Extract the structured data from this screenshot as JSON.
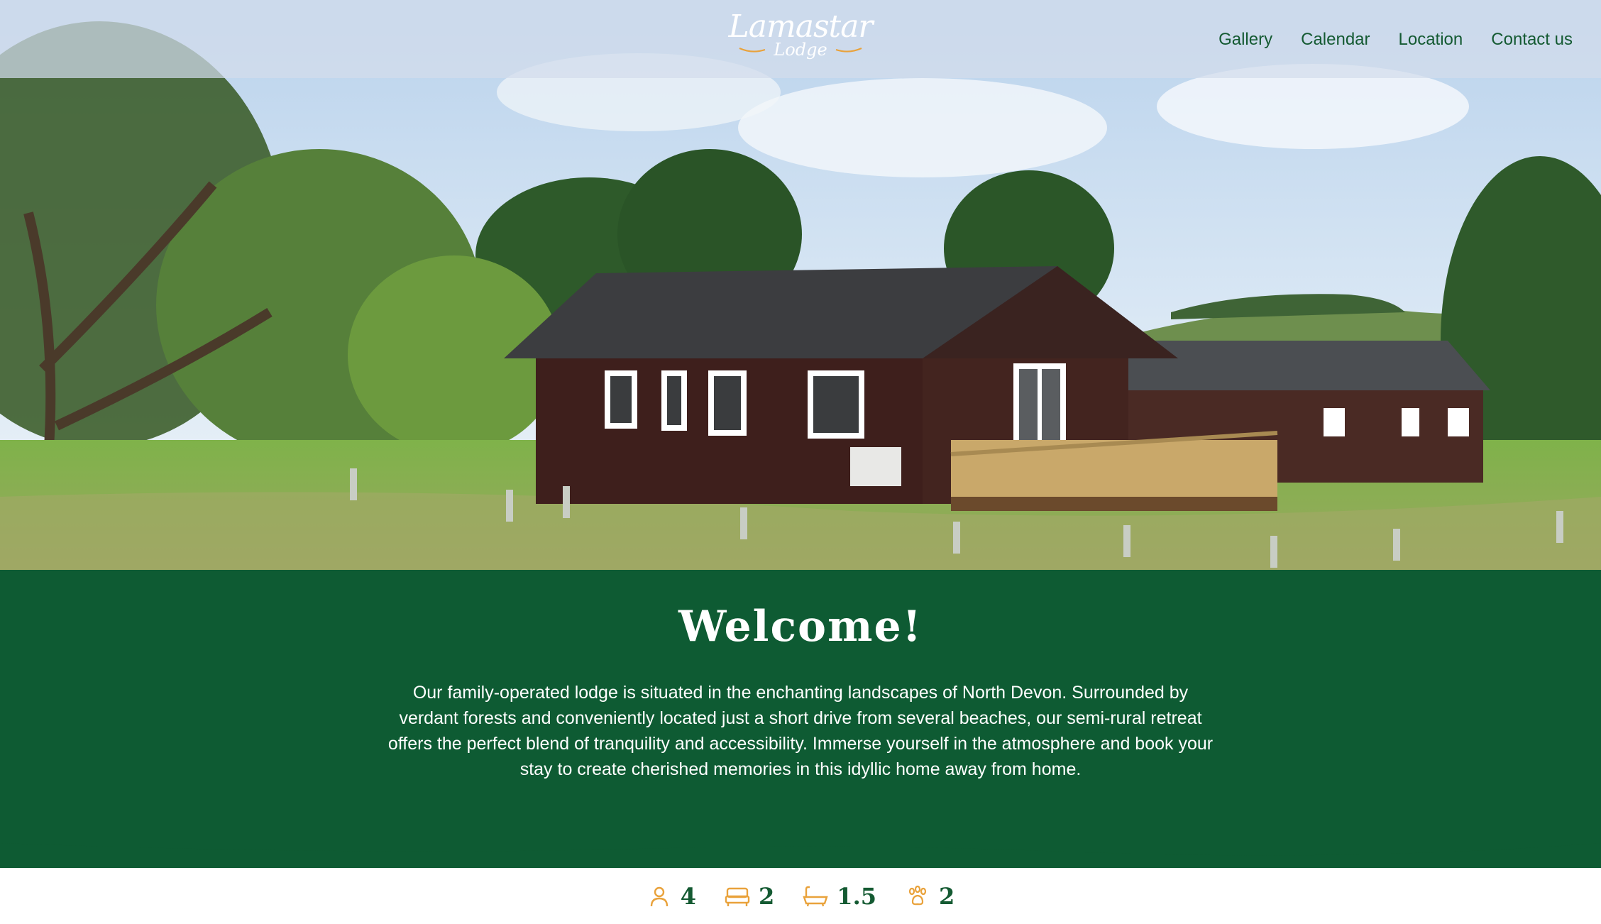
{
  "header": {
    "logo": {
      "main": "Lamastar",
      "sub": "Lodge"
    },
    "nav": [
      {
        "label": "Gallery"
      },
      {
        "label": "Calendar"
      },
      {
        "label": "Location"
      },
      {
        "label": "Contact us"
      }
    ]
  },
  "hero": {
    "icon": "lodge-photo"
  },
  "welcome": {
    "title": "Welcome!",
    "text": "Our family-operated lodge is situated in the enchanting landscapes of North Devon. Surrounded by verdant forests and conveniently located just a short drive from several beaches, our semi-rural retreat offers the perfect blend of tranquility and accessibility. Immerse yourself in the atmosphere and book your stay to create cherished memories in this idyllic home away from home."
  },
  "stats": [
    {
      "icon": "guests-icon",
      "value": "4"
    },
    {
      "icon": "bedrooms-icon",
      "value": "2"
    },
    {
      "icon": "bathrooms-icon",
      "value": "1.5"
    },
    {
      "icon": "pets-icon",
      "value": "2"
    }
  ],
  "colors": {
    "brand_green": "#0e5b33",
    "nav_text": "#145a32",
    "accent_orange": "#e9a23b",
    "header_bg": "#d2dcec"
  }
}
